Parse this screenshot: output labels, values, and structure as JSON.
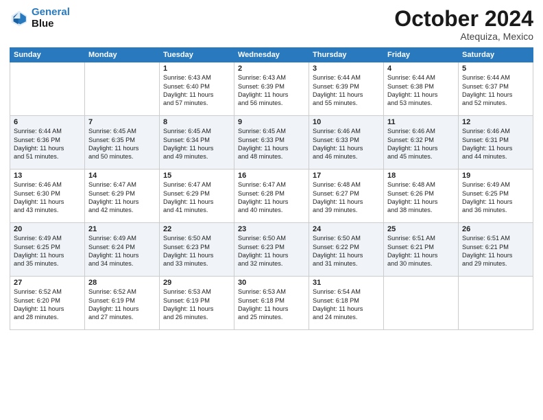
{
  "header": {
    "logo_line1": "General",
    "logo_line2": "Blue",
    "month": "October 2024",
    "location": "Atequiza, Mexico"
  },
  "days_of_week": [
    "Sunday",
    "Monday",
    "Tuesday",
    "Wednesday",
    "Thursday",
    "Friday",
    "Saturday"
  ],
  "weeks": [
    [
      {
        "day": "",
        "lines": []
      },
      {
        "day": "",
        "lines": []
      },
      {
        "day": "1",
        "lines": [
          "Sunrise: 6:43 AM",
          "Sunset: 6:40 PM",
          "Daylight: 11 hours",
          "and 57 minutes."
        ]
      },
      {
        "day": "2",
        "lines": [
          "Sunrise: 6:43 AM",
          "Sunset: 6:39 PM",
          "Daylight: 11 hours",
          "and 56 minutes."
        ]
      },
      {
        "day": "3",
        "lines": [
          "Sunrise: 6:44 AM",
          "Sunset: 6:39 PM",
          "Daylight: 11 hours",
          "and 55 minutes."
        ]
      },
      {
        "day": "4",
        "lines": [
          "Sunrise: 6:44 AM",
          "Sunset: 6:38 PM",
          "Daylight: 11 hours",
          "and 53 minutes."
        ]
      },
      {
        "day": "5",
        "lines": [
          "Sunrise: 6:44 AM",
          "Sunset: 6:37 PM",
          "Daylight: 11 hours",
          "and 52 minutes."
        ]
      }
    ],
    [
      {
        "day": "6",
        "lines": [
          "Sunrise: 6:44 AM",
          "Sunset: 6:36 PM",
          "Daylight: 11 hours",
          "and 51 minutes."
        ]
      },
      {
        "day": "7",
        "lines": [
          "Sunrise: 6:45 AM",
          "Sunset: 6:35 PM",
          "Daylight: 11 hours",
          "and 50 minutes."
        ]
      },
      {
        "day": "8",
        "lines": [
          "Sunrise: 6:45 AM",
          "Sunset: 6:34 PM",
          "Daylight: 11 hours",
          "and 49 minutes."
        ]
      },
      {
        "day": "9",
        "lines": [
          "Sunrise: 6:45 AM",
          "Sunset: 6:33 PM",
          "Daylight: 11 hours",
          "and 48 minutes."
        ]
      },
      {
        "day": "10",
        "lines": [
          "Sunrise: 6:46 AM",
          "Sunset: 6:33 PM",
          "Daylight: 11 hours",
          "and 46 minutes."
        ]
      },
      {
        "day": "11",
        "lines": [
          "Sunrise: 6:46 AM",
          "Sunset: 6:32 PM",
          "Daylight: 11 hours",
          "and 45 minutes."
        ]
      },
      {
        "day": "12",
        "lines": [
          "Sunrise: 6:46 AM",
          "Sunset: 6:31 PM",
          "Daylight: 11 hours",
          "and 44 minutes."
        ]
      }
    ],
    [
      {
        "day": "13",
        "lines": [
          "Sunrise: 6:46 AM",
          "Sunset: 6:30 PM",
          "Daylight: 11 hours",
          "and 43 minutes."
        ]
      },
      {
        "day": "14",
        "lines": [
          "Sunrise: 6:47 AM",
          "Sunset: 6:29 PM",
          "Daylight: 11 hours",
          "and 42 minutes."
        ]
      },
      {
        "day": "15",
        "lines": [
          "Sunrise: 6:47 AM",
          "Sunset: 6:29 PM",
          "Daylight: 11 hours",
          "and 41 minutes."
        ]
      },
      {
        "day": "16",
        "lines": [
          "Sunrise: 6:47 AM",
          "Sunset: 6:28 PM",
          "Daylight: 11 hours",
          "and 40 minutes."
        ]
      },
      {
        "day": "17",
        "lines": [
          "Sunrise: 6:48 AM",
          "Sunset: 6:27 PM",
          "Daylight: 11 hours",
          "and 39 minutes."
        ]
      },
      {
        "day": "18",
        "lines": [
          "Sunrise: 6:48 AM",
          "Sunset: 6:26 PM",
          "Daylight: 11 hours",
          "and 38 minutes."
        ]
      },
      {
        "day": "19",
        "lines": [
          "Sunrise: 6:49 AM",
          "Sunset: 6:25 PM",
          "Daylight: 11 hours",
          "and 36 minutes."
        ]
      }
    ],
    [
      {
        "day": "20",
        "lines": [
          "Sunrise: 6:49 AM",
          "Sunset: 6:25 PM",
          "Daylight: 11 hours",
          "and 35 minutes."
        ]
      },
      {
        "day": "21",
        "lines": [
          "Sunrise: 6:49 AM",
          "Sunset: 6:24 PM",
          "Daylight: 11 hours",
          "and 34 minutes."
        ]
      },
      {
        "day": "22",
        "lines": [
          "Sunrise: 6:50 AM",
          "Sunset: 6:23 PM",
          "Daylight: 11 hours",
          "and 33 minutes."
        ]
      },
      {
        "day": "23",
        "lines": [
          "Sunrise: 6:50 AM",
          "Sunset: 6:23 PM",
          "Daylight: 11 hours",
          "and 32 minutes."
        ]
      },
      {
        "day": "24",
        "lines": [
          "Sunrise: 6:50 AM",
          "Sunset: 6:22 PM",
          "Daylight: 11 hours",
          "and 31 minutes."
        ]
      },
      {
        "day": "25",
        "lines": [
          "Sunrise: 6:51 AM",
          "Sunset: 6:21 PM",
          "Daylight: 11 hours",
          "and 30 minutes."
        ]
      },
      {
        "day": "26",
        "lines": [
          "Sunrise: 6:51 AM",
          "Sunset: 6:21 PM",
          "Daylight: 11 hours",
          "and 29 minutes."
        ]
      }
    ],
    [
      {
        "day": "27",
        "lines": [
          "Sunrise: 6:52 AM",
          "Sunset: 6:20 PM",
          "Daylight: 11 hours",
          "and 28 minutes."
        ]
      },
      {
        "day": "28",
        "lines": [
          "Sunrise: 6:52 AM",
          "Sunset: 6:19 PM",
          "Daylight: 11 hours",
          "and 27 minutes."
        ]
      },
      {
        "day": "29",
        "lines": [
          "Sunrise: 6:53 AM",
          "Sunset: 6:19 PM",
          "Daylight: 11 hours",
          "and 26 minutes."
        ]
      },
      {
        "day": "30",
        "lines": [
          "Sunrise: 6:53 AM",
          "Sunset: 6:18 PM",
          "Daylight: 11 hours",
          "and 25 minutes."
        ]
      },
      {
        "day": "31",
        "lines": [
          "Sunrise: 6:54 AM",
          "Sunset: 6:18 PM",
          "Daylight: 11 hours",
          "and 24 minutes."
        ]
      },
      {
        "day": "",
        "lines": []
      },
      {
        "day": "",
        "lines": []
      }
    ]
  ]
}
